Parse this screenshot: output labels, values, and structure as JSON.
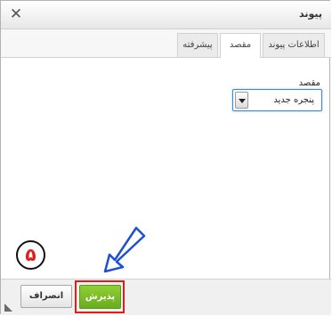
{
  "dialog": {
    "title": "پیوند",
    "close_icon": "close-icon"
  },
  "tabs": [
    {
      "label": "اطلاعات پیوند",
      "active": false
    },
    {
      "label": "مقصد",
      "active": true
    },
    {
      "label": "پیشرفته",
      "active": false
    }
  ],
  "target": {
    "field_label": "مقصد",
    "selected_value": "پنجره جدید"
  },
  "footer": {
    "ok_label": "پذیرش",
    "cancel_label": "انصراف"
  },
  "annotation": {
    "step_number": "۵",
    "step_color": "#e21b1b",
    "arrow_color": "#1f4fd6"
  },
  "colors": {
    "ok_button": "#7cbf29",
    "highlight_border": "#e21b1b",
    "focus_border": "#3b87d8"
  }
}
